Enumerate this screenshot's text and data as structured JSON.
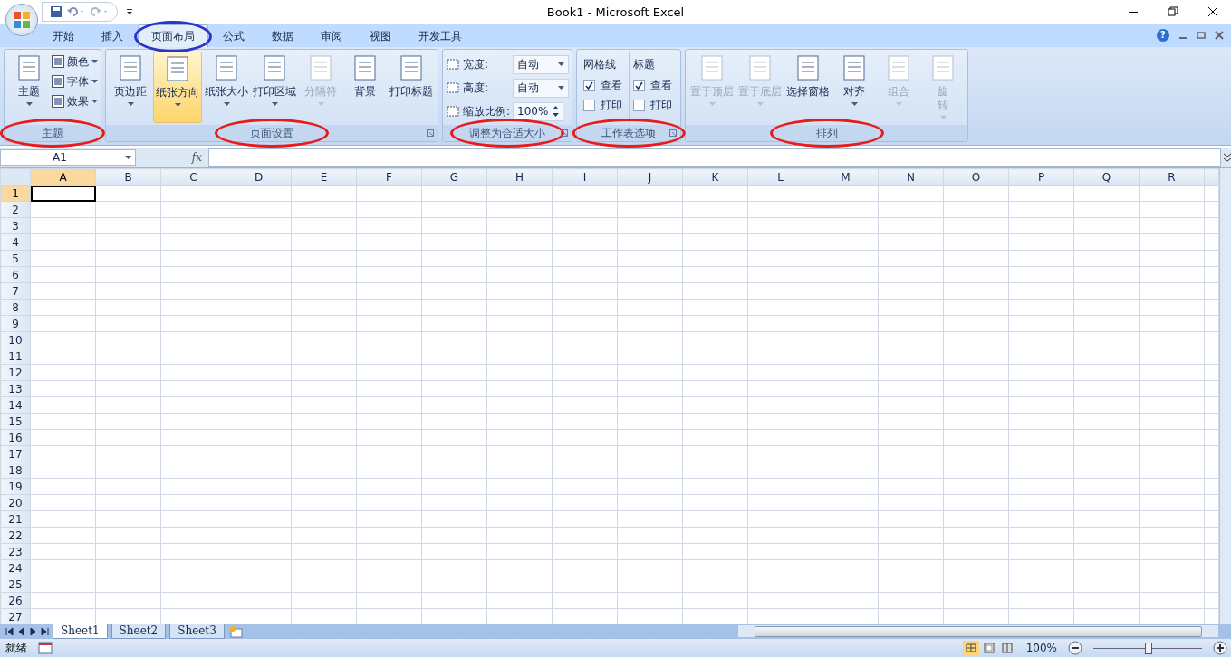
{
  "window": {
    "title": "Book1 - Microsoft Excel"
  },
  "tabs": [
    {
      "label": "开始",
      "selected": false,
      "circled": false
    },
    {
      "label": "插入",
      "selected": false,
      "circled": false
    },
    {
      "label": "页面布局",
      "selected": true,
      "circled": true
    },
    {
      "label": "公式",
      "selected": false,
      "circled": false
    },
    {
      "label": "数据",
      "selected": false,
      "circled": false
    },
    {
      "label": "审阅",
      "selected": false,
      "circled": false
    },
    {
      "label": "视图",
      "selected": false,
      "circled": false
    },
    {
      "label": "开发工具",
      "selected": false,
      "circled": false
    }
  ],
  "ribbon_groups": [
    {
      "kind": "theme",
      "title": "主题",
      "circled": true,
      "launcher": false,
      "big": [
        {
          "label": "主题",
          "dropdown": true,
          "disabled": false,
          "highlighted": false
        }
      ],
      "small": [
        {
          "label": "颜色",
          "dropdown": true
        },
        {
          "label": "字体",
          "dropdown": true
        },
        {
          "label": "效果",
          "dropdown": true
        }
      ]
    },
    {
      "kind": "buttons",
      "title": "页面设置",
      "circled": true,
      "launcher": true,
      "big": [
        {
          "label": "页边距",
          "dropdown": true,
          "disabled": false,
          "highlighted": false
        },
        {
          "label": "纸张方向",
          "dropdown": true,
          "disabled": false,
          "highlighted": true
        },
        {
          "label": "纸张大小",
          "dropdown": true,
          "disabled": false,
          "highlighted": false
        },
        {
          "label": "打印区域",
          "dropdown": true,
          "disabled": false,
          "highlighted": false
        },
        {
          "label": "分隔符",
          "dropdown": true,
          "disabled": true,
          "highlighted": false
        },
        {
          "label": "背景",
          "dropdown": false,
          "disabled": false,
          "highlighted": false
        },
        {
          "label": "打印标题",
          "dropdown": false,
          "disabled": false,
          "highlighted": false
        }
      ]
    },
    {
      "kind": "scale",
      "title": "调整为合适大小",
      "circled": true,
      "launcher": true,
      "fields": [
        {
          "kind": "dropdown",
          "label": "宽度:",
          "value": "自动"
        },
        {
          "kind": "dropdown",
          "label": "高度:",
          "value": "自动"
        },
        {
          "kind": "spinner",
          "label": "缩放比例:",
          "value": "100%"
        }
      ]
    },
    {
      "kind": "options",
      "title": "工作表选项",
      "circled": true,
      "launcher": true,
      "columns": [
        {
          "heading": "网格线",
          "checks": [
            {
              "label": "查看",
              "checked": true
            },
            {
              "label": "打印",
              "checked": false
            }
          ]
        },
        {
          "heading": "标题",
          "checks": [
            {
              "label": "查看",
              "checked": true
            },
            {
              "label": "打印",
              "checked": false
            }
          ]
        }
      ]
    },
    {
      "kind": "buttons",
      "title": "排列",
      "circled": true,
      "launcher": false,
      "big": [
        {
          "label": "置于顶层",
          "dropdown": true,
          "disabled": true,
          "highlighted": false
        },
        {
          "label": "置于底层",
          "dropdown": true,
          "disabled": true,
          "highlighted": false
        },
        {
          "label": "选择窗格",
          "dropdown": false,
          "disabled": false,
          "highlighted": false
        },
        {
          "label": "对齐",
          "dropdown": true,
          "disabled": false,
          "highlighted": false
        },
        {
          "label": "组合",
          "dropdown": true,
          "disabled": true,
          "highlighted": false
        },
        {
          "label": "旋转",
          "dropdown": true,
          "disabled": true,
          "highlighted": false,
          "wrap": true
        }
      ]
    }
  ],
  "help": {
    "icon": "?"
  },
  "formula_bar": {
    "name_box": "A1",
    "fx": "fx"
  },
  "grid": {
    "columns": [
      "A",
      "B",
      "C",
      "D",
      "E",
      "F",
      "G",
      "H",
      "I",
      "J",
      "K",
      "L",
      "M",
      "N",
      "O",
      "P",
      "Q",
      "R"
    ],
    "rows": [
      "1",
      "2",
      "3",
      "4",
      "5",
      "6",
      "7",
      "8",
      "9",
      "10",
      "11",
      "12",
      "13",
      "14",
      "15",
      "16",
      "17",
      "18",
      "19",
      "20",
      "21",
      "22",
      "23",
      "24",
      "25",
      "26",
      "27"
    ]
  },
  "sheet_tabs": [
    {
      "label": "Sheet1",
      "selected": true
    },
    {
      "label": "Sheet2",
      "selected": false
    },
    {
      "label": "Sheet3",
      "selected": false
    }
  ],
  "status_bar": {
    "status": "就绪",
    "zoom": "100%",
    "zoom_slider": {
      "level": 0.5
    }
  }
}
